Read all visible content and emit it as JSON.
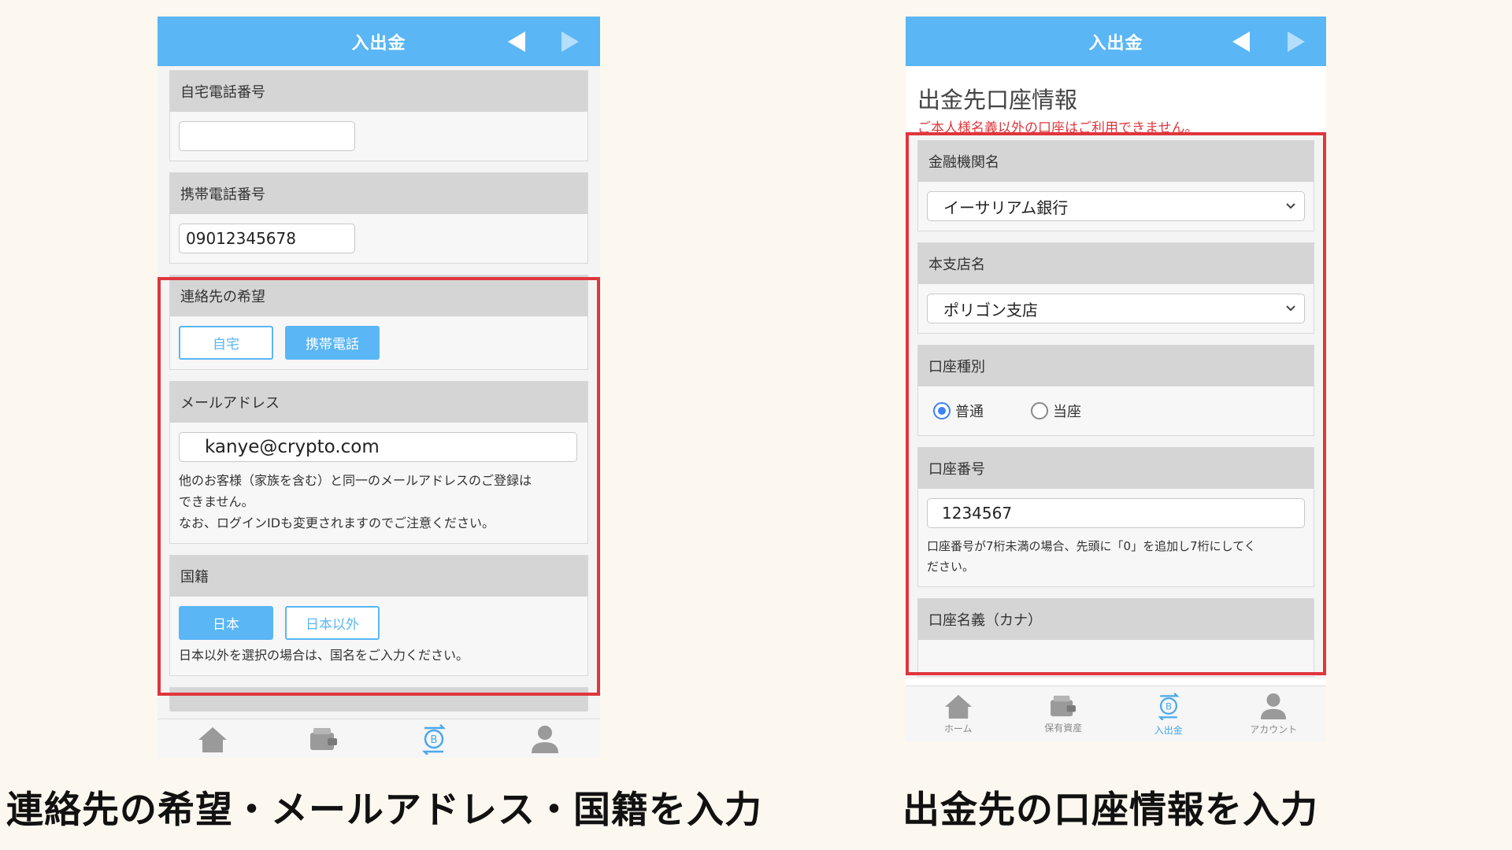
{
  "left": {
    "header_title": "入出金",
    "home_phone": {
      "label": "自宅電話番号",
      "value": ""
    },
    "mobile_phone": {
      "label": "携帯電話番号",
      "value": "09012345678"
    },
    "contact_pref": {
      "label": "連絡先の希望",
      "options": [
        "自宅",
        "携帯電話"
      ],
      "selected": "携帯電話"
    },
    "email": {
      "label": "メールアドレス",
      "value": "kanye@crypto.com",
      "note1": "他のお客様（家族を含む）と同一のメールアドレスのご登録は",
      "note2": "できません。",
      "note3": "なお、ログインIDも変更されますのでご注意ください。"
    },
    "nationality": {
      "label": "国籍",
      "options": [
        "日本",
        "日本以外"
      ],
      "selected": "日本",
      "note": "日本以外を選択の場合は、国名をご入力ください。"
    }
  },
  "right": {
    "header_title": "入出金",
    "title": "出金先口座情報",
    "warning": "ご本人様名義以外の口座はご利用できません。",
    "bank": {
      "label": "金融機関名",
      "value": "イーサリアム銀行"
    },
    "branch": {
      "label": "本支店名",
      "value": "ポリゴン支店"
    },
    "account_type": {
      "label": "口座種別",
      "options": [
        "普通",
        "当座"
      ],
      "selected": "普通"
    },
    "account_number": {
      "label": "口座番号",
      "value": "1234567",
      "note1": "口座番号が7桁未満の場合、先頭に「0」を追加し7桁にしてく",
      "note2": "ださい。"
    },
    "account_name": {
      "label": "口座名義（カナ）",
      "value": ""
    },
    "tabs": [
      {
        "label": "ホーム",
        "icon": "home-icon"
      },
      {
        "label": "保有資産",
        "icon": "wallet-icon"
      },
      {
        "label": "入出金",
        "icon": "bitcoin-transfer-icon"
      },
      {
        "label": "アカウント",
        "icon": "person-icon"
      }
    ],
    "active_tab": "入出金"
  },
  "captions": {
    "left": "連絡先の希望・メールアドレス・国籍を入力",
    "right": "出金先の口座情報を入力"
  },
  "colors": {
    "accent": "#5ab6f5",
    "highlight": "#e0363c",
    "background": "#fdf8ef"
  }
}
